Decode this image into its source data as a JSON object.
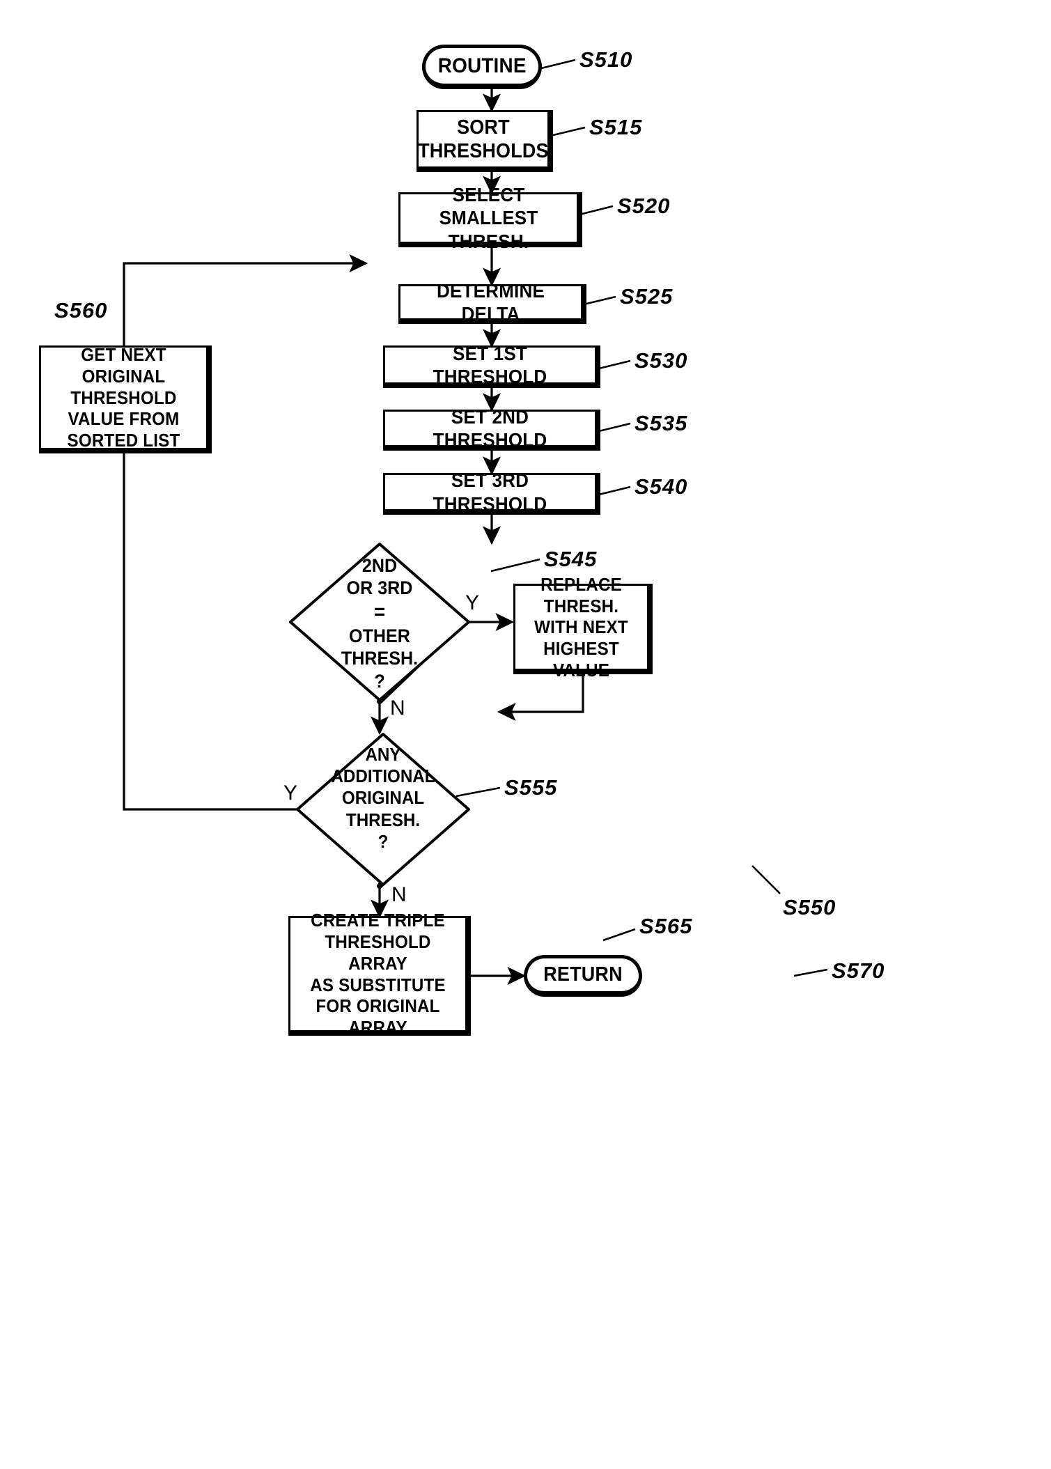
{
  "figure": {
    "type": "patent-flowchart",
    "title": ""
  },
  "nodes": {
    "start": {
      "label": "ROUTINE",
      "ref": "S510"
    },
    "sort": {
      "label": "SORT\nTHRESHOLDS",
      "ref": "S515"
    },
    "select": {
      "label": "SELECT\nSMALLEST THRESH.",
      "ref": "S520"
    },
    "delta": {
      "label": "DETERMINE DELTA",
      "ref": "S525"
    },
    "set1": {
      "label": "SET 1ST THRESHOLD",
      "ref": "S530"
    },
    "set2": {
      "label": "SET 2ND THRESHOLD",
      "ref": "S535"
    },
    "set3": {
      "label": "SET 3RD THRESHOLD",
      "ref": "S540"
    },
    "decision1": {
      "label": "2ND\nOR 3RD\n=\nOTHER\nTHRESH.\n?",
      "ref": "S545"
    },
    "replace": {
      "label": "REPLACE THRESH.\nWITH NEXT\nHIGHEST VALUE",
      "ref": "S550"
    },
    "decision2": {
      "label": "ANY\nADDITIONAL\nORIGINAL\nTHRESH.\n?",
      "ref": "S555"
    },
    "getnext": {
      "label": "GET NEXT\nORIGINAL THRESHOLD\nVALUE FROM\nSORTED LIST",
      "ref": "S560"
    },
    "create": {
      "label": "CREATE TRIPLE\nTHRESHOLD ARRAY\nAS SUBSTITUTE\nFOR ORIGINAL ARRAY",
      "ref": "S565"
    },
    "return": {
      "label": "RETURN",
      "ref": "S570"
    }
  },
  "branches": {
    "d1_yes": "Y",
    "d1_no": "N",
    "d2_yes": "Y",
    "d2_no": "N"
  },
  "colors": {
    "ink": "#000000",
    "paper": "#ffffff"
  }
}
